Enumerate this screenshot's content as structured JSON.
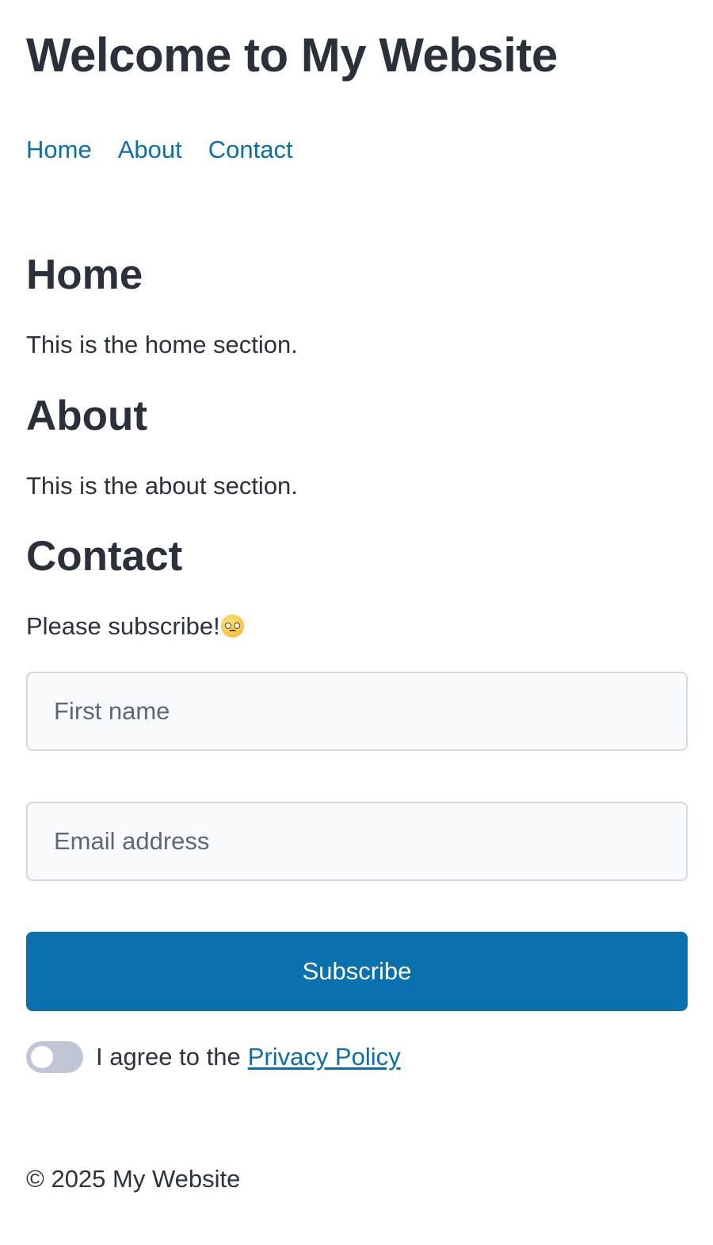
{
  "header": {
    "title": "Welcome to My Website"
  },
  "nav": {
    "items": [
      "Home",
      "About",
      "Contact"
    ]
  },
  "sections": {
    "home": {
      "title": "Home",
      "text": "This is the home section."
    },
    "about": {
      "title": "About",
      "text": "This is the about section."
    },
    "contact": {
      "title": "Contact",
      "text": "Please subscribe!",
      "emoji": "pleading-face-icon"
    }
  },
  "form": {
    "first_name_placeholder": "First name",
    "email_placeholder": "Email address",
    "first_name_value": "",
    "email_value": "",
    "subscribe_label": "Subscribe",
    "agree_text": "I agree to the",
    "privacy_link": "Privacy Policy",
    "agree_checked": false
  },
  "footer": {
    "text": "© 2025 My Website"
  },
  "colors": {
    "accent": "#0a70ae",
    "text": "#2d333d",
    "toggle_off": "#c0c6d6",
    "input_border": "#d3d8df",
    "input_bg": "#f9fafb"
  }
}
